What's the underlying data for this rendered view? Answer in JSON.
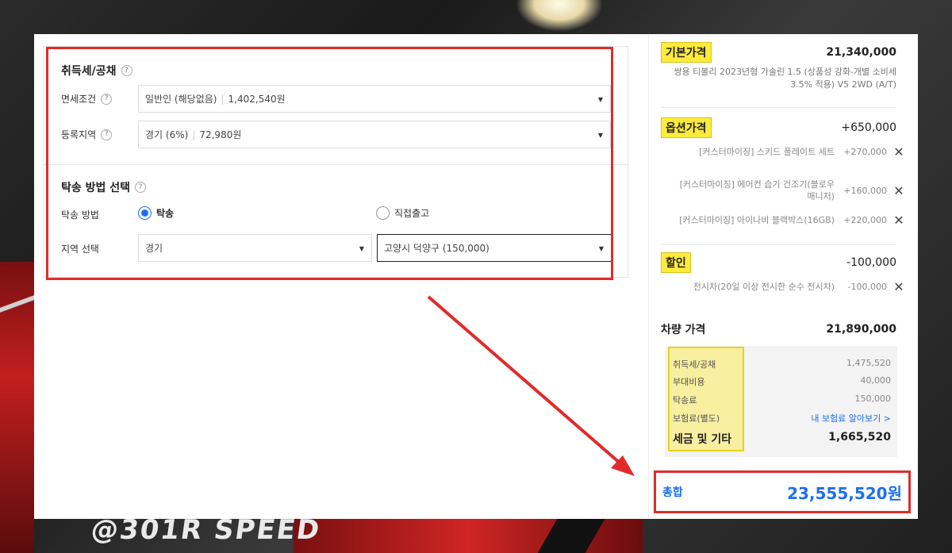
{
  "colors": {
    "accent": "#1d6ff2",
    "highlight": "#ffeb3b",
    "annotation": "#e22a2a"
  },
  "tax": {
    "title": "취득세/공채",
    "exemption_label": "면세조건",
    "exemption_value": "일반인 (해당없음)",
    "exemption_amount": "1,402,540원",
    "region_label": "등록지역",
    "region_value": "경기 (6%)",
    "region_amount": "72,980원"
  },
  "delivery": {
    "title": "탁송 방법 선택",
    "method_label": "탁송 방법",
    "method_options": [
      "탁송",
      "직접출고"
    ],
    "method_selected": "탁송",
    "area_label": "지역 선택",
    "area_province": "경기",
    "area_city": "고양시 덕양구 (150,000)"
  },
  "summary": {
    "base_label": "기본가격",
    "base_value": "21,340,000",
    "base_desc": "쌍용 티볼리 2023년형 가솔린 1.5 (상품성 강화-개별 소비세 3.5% 적용) V5 2WD (A/T)",
    "option_label": "옵션가격",
    "option_value": "+650,000",
    "options": [
      {
        "name": "[커스터마이징] 스키드 플레이트 세트",
        "value": "+270,000"
      },
      {
        "name": "[커스터마이징] 에어컨 습기 건조기(블로우 매니저)",
        "value": "+160,000"
      },
      {
        "name": "[커스터마이징] 아이나비 블랙박스(16GB)",
        "value": "+220,000"
      }
    ],
    "discount_label": "할인",
    "discount_value": "-100,000",
    "discount_item": {
      "name": "전시차(20일 이상 전시한 순수 전시차)",
      "value": "-100,000"
    },
    "vehicle_label": "차량 가격",
    "vehicle_value": "21,890,000",
    "acq_label": "취득세/공채",
    "acq_value": "1,475,520",
    "extra_label": "부대비용",
    "extra_value": "40,000",
    "delivery_label": "탁송료",
    "delivery_value": "150,000",
    "insurance_label": "보험료(별도)",
    "insurance_link": "내 보험료 알아보기 >",
    "tax_total_label": "세금 및 기타",
    "tax_total_value": "1,665,520",
    "total_label": "총합",
    "total_value": "23,555,520원"
  },
  "background": {
    "logo_text": "@301R SPEED"
  }
}
